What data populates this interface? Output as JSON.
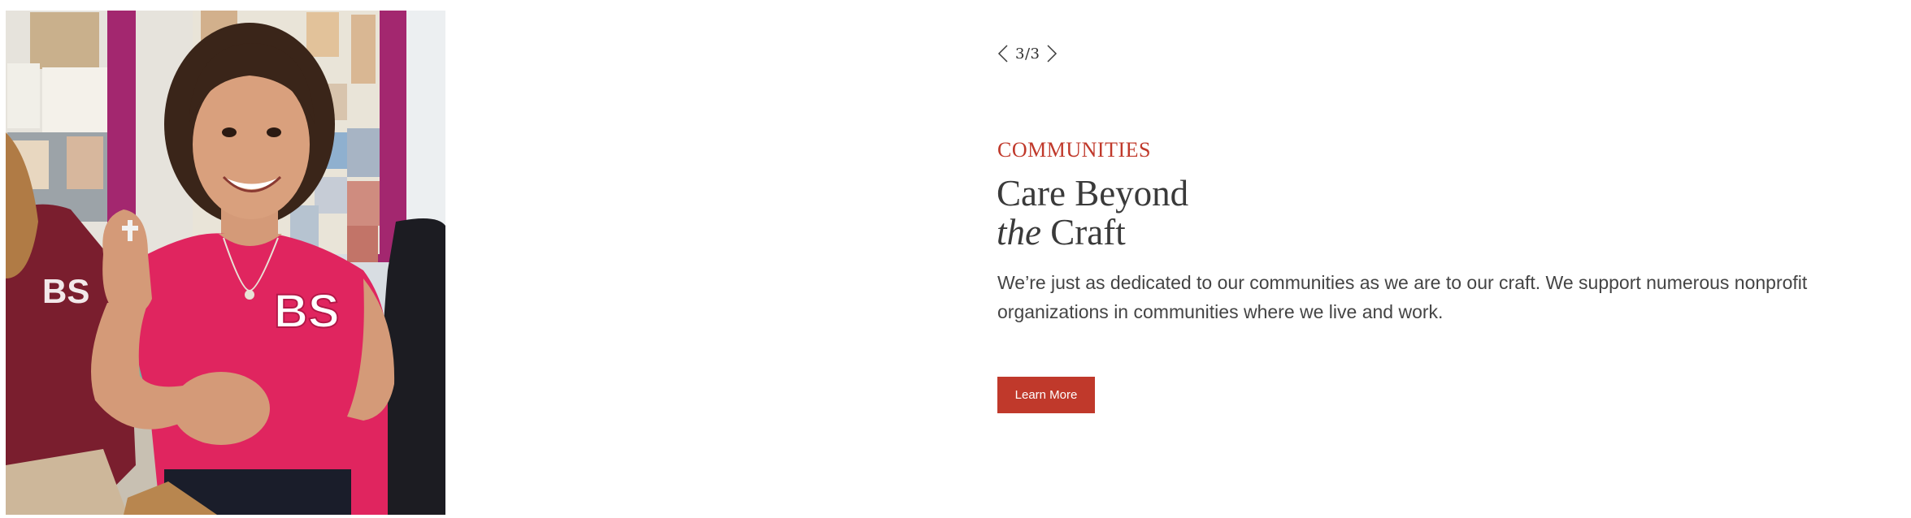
{
  "photo": {
    "alt": ""
  },
  "pager": {
    "count": "3/3",
    "prev_icon": "chevron-left-icon",
    "next_icon": "chevron-right-icon"
  },
  "feature": {
    "eyebrow": "COMMUNITIES",
    "headline_line1": "Care Beyond",
    "headline_italic": "the",
    "headline_line2_rest": " Craft",
    "body": "We’re just as dedicated to our communities as we are to our craft. We support numerous nonprofit organizations in communities where we live and work.",
    "cta_label": "Learn More"
  },
  "colors": {
    "accent": "#c0392b",
    "heading": "#3a3a3a",
    "body": "#444444"
  }
}
